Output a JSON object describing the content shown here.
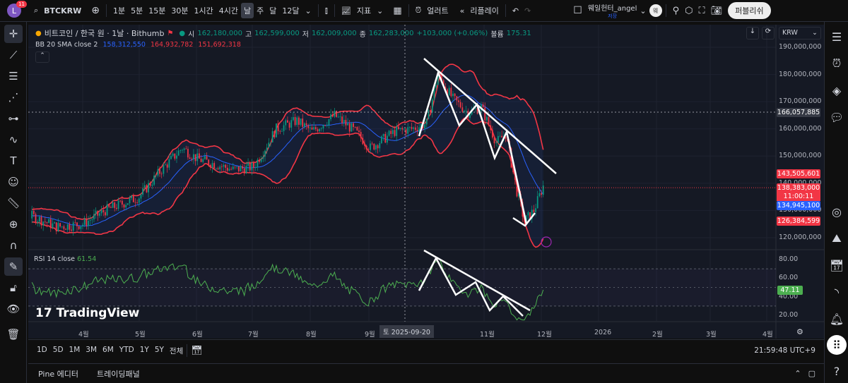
{
  "toolbar": {
    "avatar": "L",
    "notifications": "11",
    "symbol": "BTCKRW",
    "intervals": [
      "1분",
      "5분",
      "15분",
      "30분",
      "1시간",
      "4시간",
      "날",
      "주",
      "달",
      "12달"
    ],
    "active_interval": "날",
    "indicators": "지표",
    "alerts": "얼러트",
    "replay": "리플레이",
    "layout_name": "웨일헌터_angel",
    "layout_status": "저장",
    "user_badge": "웨",
    "publish": "퍼블리쉬"
  },
  "legend": {
    "title": "비트코인 / 한국 원 · 1날 · Bithumb",
    "o_label": "시",
    "open": "162,180,000",
    "h_label": "고",
    "high": "162,599,000",
    "l_label": "저",
    "low": "162,009,000",
    "c_label": "종",
    "close": "162,283,000",
    "change": "+103,000 (+0.06%)",
    "vol_label": "볼륨",
    "volume": "175.31",
    "bb_label": "BB 20 SMA close 2",
    "bb_basis": "158,312,550",
    "bb_upper": "164,932,782",
    "bb_lower": "151,692,318",
    "rsi_label": "RSI 14 close",
    "rsi_value": "61.54"
  },
  "currency": "KRW",
  "price_axis": [
    "190,000,000",
    "180,000,000",
    "170,000,000",
    "160,000,000",
    "150,000,000",
    "140,000,000",
    "130,000,000",
    "120,000,000"
  ],
  "rsi_axis": [
    "80.00",
    "60.00",
    "40.00",
    "20.00"
  ],
  "price_tags": {
    "crosshair": "166,057,885",
    "bb_upper": "143,505,601",
    "last": "138,383,000",
    "countdown": "11:00:11",
    "basis": "134,945,100",
    "bb_lower": "126,384,599",
    "rsi": "47.11"
  },
  "time_axis": [
    "4월",
    "5월",
    "6월",
    "7월",
    "8월",
    "9월",
    "11월",
    "12월",
    "2026",
    "2월",
    "3월",
    "4월"
  ],
  "crosshair_date": "토 2025-09-20",
  "watermark": "TradingView",
  "ranges": [
    "1D",
    "5D",
    "1M",
    "3M",
    "6M",
    "YTD",
    "1Y",
    "5Y",
    "전체"
  ],
  "clock": "21:59:48 UTC+9",
  "panels": [
    "Pine 에디터",
    "트레이딩패널"
  ],
  "colors": {
    "up": "#089981",
    "down": "#f23645",
    "bb": "#f23645",
    "basis": "#2962ff",
    "rsi": "#4caf50",
    "background": "#151924"
  },
  "chart_data": {
    "type": "candlestick",
    "approximate_close_path_million_krw": [
      [
        "2025-03-05",
        128
      ],
      [
        "2025-03-18",
        124
      ],
      [
        "2025-04-01",
        125
      ],
      [
        "2025-04-13",
        130
      ],
      [
        "2025-05-01",
        135
      ],
      [
        "2025-05-13",
        145
      ],
      [
        "2025-05-24",
        153
      ],
      [
        "2025-06-01",
        149
      ],
      [
        "2025-06-20",
        145
      ],
      [
        "2025-07-01",
        146
      ],
      [
        "2025-07-13",
        160
      ],
      [
        "2025-07-24",
        163
      ],
      [
        "2025-08-01",
        159
      ],
      [
        "2025-08-13",
        165
      ],
      [
        "2025-08-24",
        159
      ],
      [
        "2025-09-01",
        153
      ],
      [
        "2025-09-14",
        159
      ],
      [
        "2025-09-23",
        160
      ],
      [
        "2025-10-01",
        162
      ],
      [
        "2025-10-07",
        180
      ],
      [
        "2025-10-15",
        171
      ],
      [
        "2025-10-23",
        166
      ],
      [
        "2025-10-30",
        168
      ],
      [
        "2025-11-07",
        155
      ],
      [
        "2025-11-12",
        158
      ],
      [
        "2025-11-18",
        137
      ],
      [
        "2025-11-22",
        126
      ],
      [
        "2025-11-27",
        130
      ],
      [
        "2025-12-02",
        139
      ]
    ],
    "ylim": [
      115000000,
      195000000
    ]
  }
}
